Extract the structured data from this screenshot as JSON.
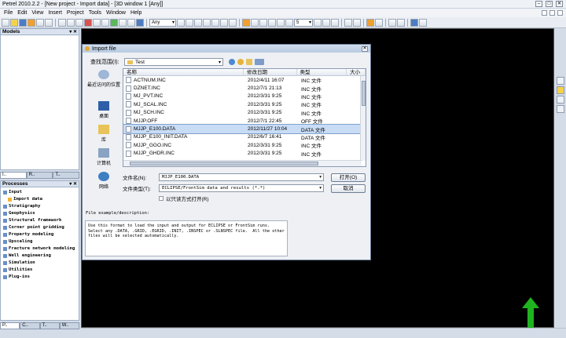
{
  "window": {
    "title": "Petrel 2010.2.2 - [New project - Import data] - [3D window 1 [Any]]"
  },
  "menu": [
    "File",
    "Edit",
    "View",
    "Insert",
    "Project",
    "Tools",
    "Window",
    "Help"
  ],
  "toolbar": {
    "domain_combo": "Any",
    "zoom_value": "5"
  },
  "models_panel": {
    "title": "Models"
  },
  "left_tabs": {
    "top": [
      "I..",
      "R..",
      "T.."
    ],
    "bottom": [
      "P..",
      "C..",
      "T..",
      "W.."
    ]
  },
  "processes": {
    "title": "Processes",
    "items": [
      {
        "label": "Input",
        "sub": false
      },
      {
        "label": "Import data",
        "sub": true
      },
      {
        "label": "Stratigraphy",
        "sub": false
      },
      {
        "label": "Geophysics",
        "sub": false
      },
      {
        "label": "Structural framework",
        "sub": false
      },
      {
        "label": "Corner point gridding",
        "sub": false
      },
      {
        "label": "Property modeling",
        "sub": false
      },
      {
        "label": "Upscaling",
        "sub": false
      },
      {
        "label": "Fracture network modeling",
        "sub": false
      },
      {
        "label": "Well engineering",
        "sub": false
      },
      {
        "label": "Simulation",
        "sub": false
      },
      {
        "label": "Utilities",
        "sub": false
      },
      {
        "label": "Plug-ins",
        "sub": false
      }
    ]
  },
  "dialog": {
    "title": "Import file",
    "look_in_label": "查找范围(I):",
    "look_in_value": "Test",
    "places": [
      "最近访问的位置",
      "桌面",
      "库",
      "计算机",
      "网络"
    ],
    "columns": [
      "名称",
      "修改日期",
      "类型",
      "大小"
    ],
    "files": [
      {
        "name": "ACTNUM.INC",
        "date": "2012/4/11 16:07",
        "type": "INC 文件",
        "selected": false
      },
      {
        "name": "DZNET.INC",
        "date": "2012/7/1 21:13",
        "type": "INC 文件",
        "selected": false
      },
      {
        "name": "MJ_PVT.INC",
        "date": "2012/3/31 9:25",
        "type": "INC 文件",
        "selected": false
      },
      {
        "name": "MJ_SCAL.INC",
        "date": "2012/3/31 9:25",
        "type": "INC 文件",
        "selected": false
      },
      {
        "name": "MJ_SCH.INC",
        "date": "2012/3/31 9:25",
        "type": "INC 文件",
        "selected": false
      },
      {
        "name": "MJJP.OFF",
        "date": "2012/7/1 22:45",
        "type": "OFF 文件",
        "selected": false
      },
      {
        "name": "MJJP_E100.DATA",
        "date": "2012/11/27 10:04",
        "type": "DATA 文件",
        "selected": true
      },
      {
        "name": "MJJP_E100_INIT.DATA",
        "date": "2012/6/7 16:41",
        "type": "DATA 文件",
        "selected": false
      },
      {
        "name": "MJJP_GGO.INC",
        "date": "2012/3/31 9:25",
        "type": "INC 文件",
        "selected": false
      },
      {
        "name": "MJJP_GHDR.INC",
        "date": "2012/3/31 9:25",
        "type": "INC 文件",
        "selected": false
      }
    ],
    "filename_label": "文件名(N):",
    "filename_value": "MJJP_E100.DATA",
    "filetype_label": "文件类型(T):",
    "filetype_value": "ECLIPSE/FrontSim data and results (*.*)",
    "readonly_label": "以只读方式打开(R)",
    "open_label": "打开(O)",
    "cancel_label": "取消",
    "desc_label": "File example/description:",
    "desc_text": "Use this format to load the input and output for ECLIPSE or FrontSim runs.\nSelect any .DATA, .GRID, .EGRID, .INIT, .INSPEC or .SLNSPEC file.  All the other\nfiles will be selected automatically."
  },
  "colors": {
    "viewport_bg": "#000000",
    "arrow": "#1fb31f",
    "selection": "#c9dcf5"
  }
}
